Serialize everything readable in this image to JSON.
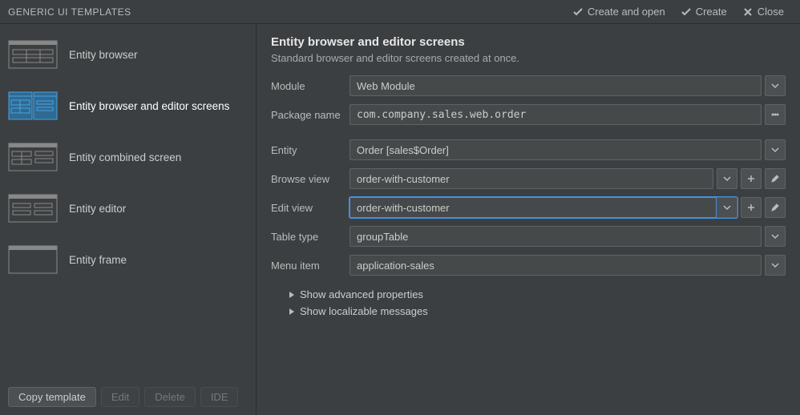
{
  "header": {
    "title": "GENERIC UI TEMPLATES",
    "create_and_open": "Create and open",
    "create": "Create",
    "close": "Close"
  },
  "sidebar": {
    "items": [
      {
        "label": "Entity browser",
        "selected": false
      },
      {
        "label": "Entity browser and editor screens",
        "selected": true
      },
      {
        "label": "Entity combined screen",
        "selected": false
      },
      {
        "label": "Entity editor",
        "selected": false
      },
      {
        "label": "Entity frame",
        "selected": false
      }
    ],
    "footer": {
      "copy": "Copy template",
      "edit": "Edit",
      "delete": "Delete",
      "ide": "IDE"
    }
  },
  "main": {
    "title": "Entity browser and editor screens",
    "description": "Standard browser and editor screens created at once.",
    "fields": {
      "module_label": "Module",
      "module_value": "Web Module",
      "package_label": "Package name",
      "package_value": "com.company.sales.web.order",
      "entity_label": "Entity",
      "entity_value": "Order [sales$Order]",
      "browse_view_label": "Browse view",
      "browse_view_value": "order-with-customer",
      "edit_view_label": "Edit view",
      "edit_view_value": "order-with-customer",
      "table_type_label": "Table type",
      "table_type_value": "groupTable",
      "menu_item_label": "Menu item",
      "menu_item_value": "application-sales"
    },
    "expanders": {
      "advanced": "Show advanced properties",
      "localizable": "Show localizable messages"
    }
  }
}
